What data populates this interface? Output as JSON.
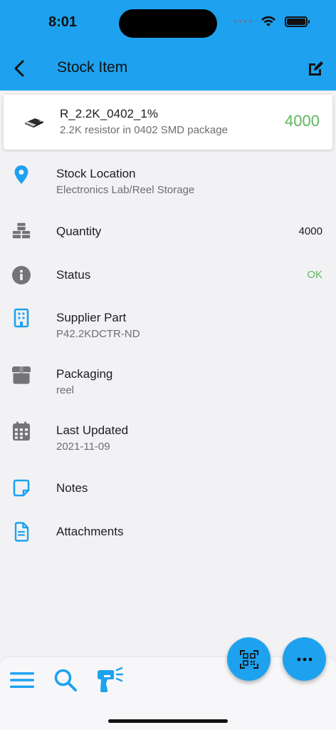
{
  "status_bar": {
    "time": "8:01"
  },
  "header": {
    "title": "Stock Item"
  },
  "part": {
    "name": "R_2.2K_0402_1%",
    "description": "2.2K resistor in 0402 SMD package",
    "quantity": "4000"
  },
  "details": {
    "location": {
      "title": "Stock Location",
      "value": "Electronics Lab/Reel Storage"
    },
    "quantity": {
      "title": "Quantity",
      "value": "4000"
    },
    "status": {
      "title": "Status",
      "value": "OK"
    },
    "supplier_part": {
      "title": "Supplier Part",
      "value": "P42.2KDCTR-ND"
    },
    "packaging": {
      "title": "Packaging",
      "value": "reel"
    },
    "last_updated": {
      "title": "Last Updated",
      "value": "2021-11-09"
    },
    "notes": {
      "title": "Notes"
    },
    "attachments": {
      "title": "Attachments"
    }
  },
  "icons": {
    "back": "chevron-left-icon",
    "edit": "edit-icon",
    "location": "map-pin-icon",
    "quantity": "boxes-icon",
    "status": "info-icon",
    "supplier": "building-icon",
    "packaging": "box-icon",
    "updated": "calendar-icon",
    "notes": "sticky-note-icon",
    "attachments": "file-icon",
    "menu": "hamburger-icon",
    "search": "search-icon",
    "scanner": "barcode-scanner-icon",
    "qr": "qr-code-icon",
    "more": "more-horizontal-icon"
  },
  "colors": {
    "brand": "#1ea2ef",
    "quantity_green": "#5cb85c",
    "status_ok": "#5cb85c",
    "icon_gray": "#737378"
  }
}
